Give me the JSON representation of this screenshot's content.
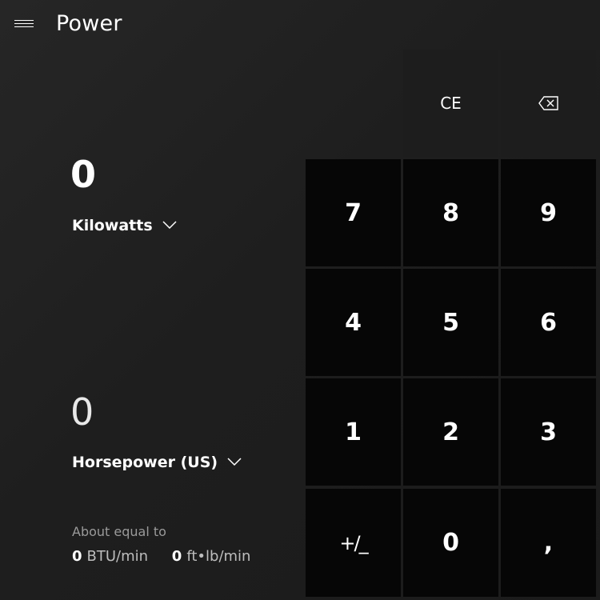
{
  "header": {
    "title": "Power",
    "menu_icon": "hamburger-menu-icon"
  },
  "converter": {
    "from_value": "0",
    "from_unit": "Kilowatts",
    "to_value": "0",
    "to_unit": "Horsepower (US)",
    "about_label": "About equal to",
    "equivalents": [
      {
        "value": "0",
        "unit": "BTU/min"
      },
      {
        "value": "0",
        "unit": "ft•lb/min"
      }
    ]
  },
  "keypad": {
    "clear_entry": "CE",
    "backspace_icon": "backspace-icon",
    "digits": {
      "d7": "7",
      "d8": "8",
      "d9": "9",
      "d4": "4",
      "d5": "5",
      "d6": "6",
      "d1": "1",
      "d2": "2",
      "d3": "3",
      "d0": "0"
    },
    "negate": "+/_",
    "decimal": ","
  },
  "colors": {
    "background": "#1f1f1f",
    "key_background": "#060606",
    "top_key_background": "#1d1d1d",
    "text": "#ffffff",
    "secondary_text": "#9a9a9a"
  }
}
